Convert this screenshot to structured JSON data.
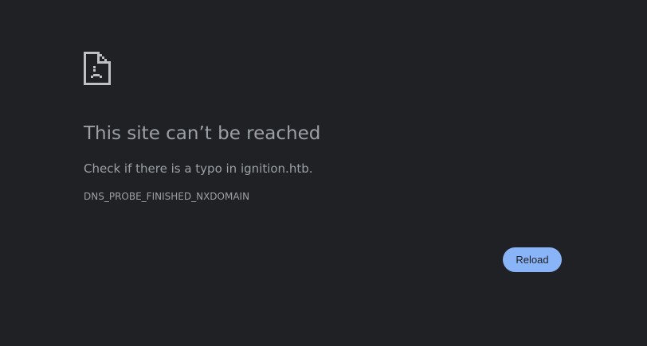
{
  "error_page": {
    "icon": "sad-document-icon",
    "headline": "This site can’t be reached",
    "suggestion": "Check if there is a typo in ignition.htb.",
    "error_code": "DNS_PROBE_FINISHED_NXDOMAIN",
    "reload_label": "Reload"
  },
  "colors": {
    "background": "#202124",
    "text": "#9aa0a6",
    "icon": "#bdc1c6",
    "button_background": "#8ab4f8",
    "button_text": "#202124"
  }
}
